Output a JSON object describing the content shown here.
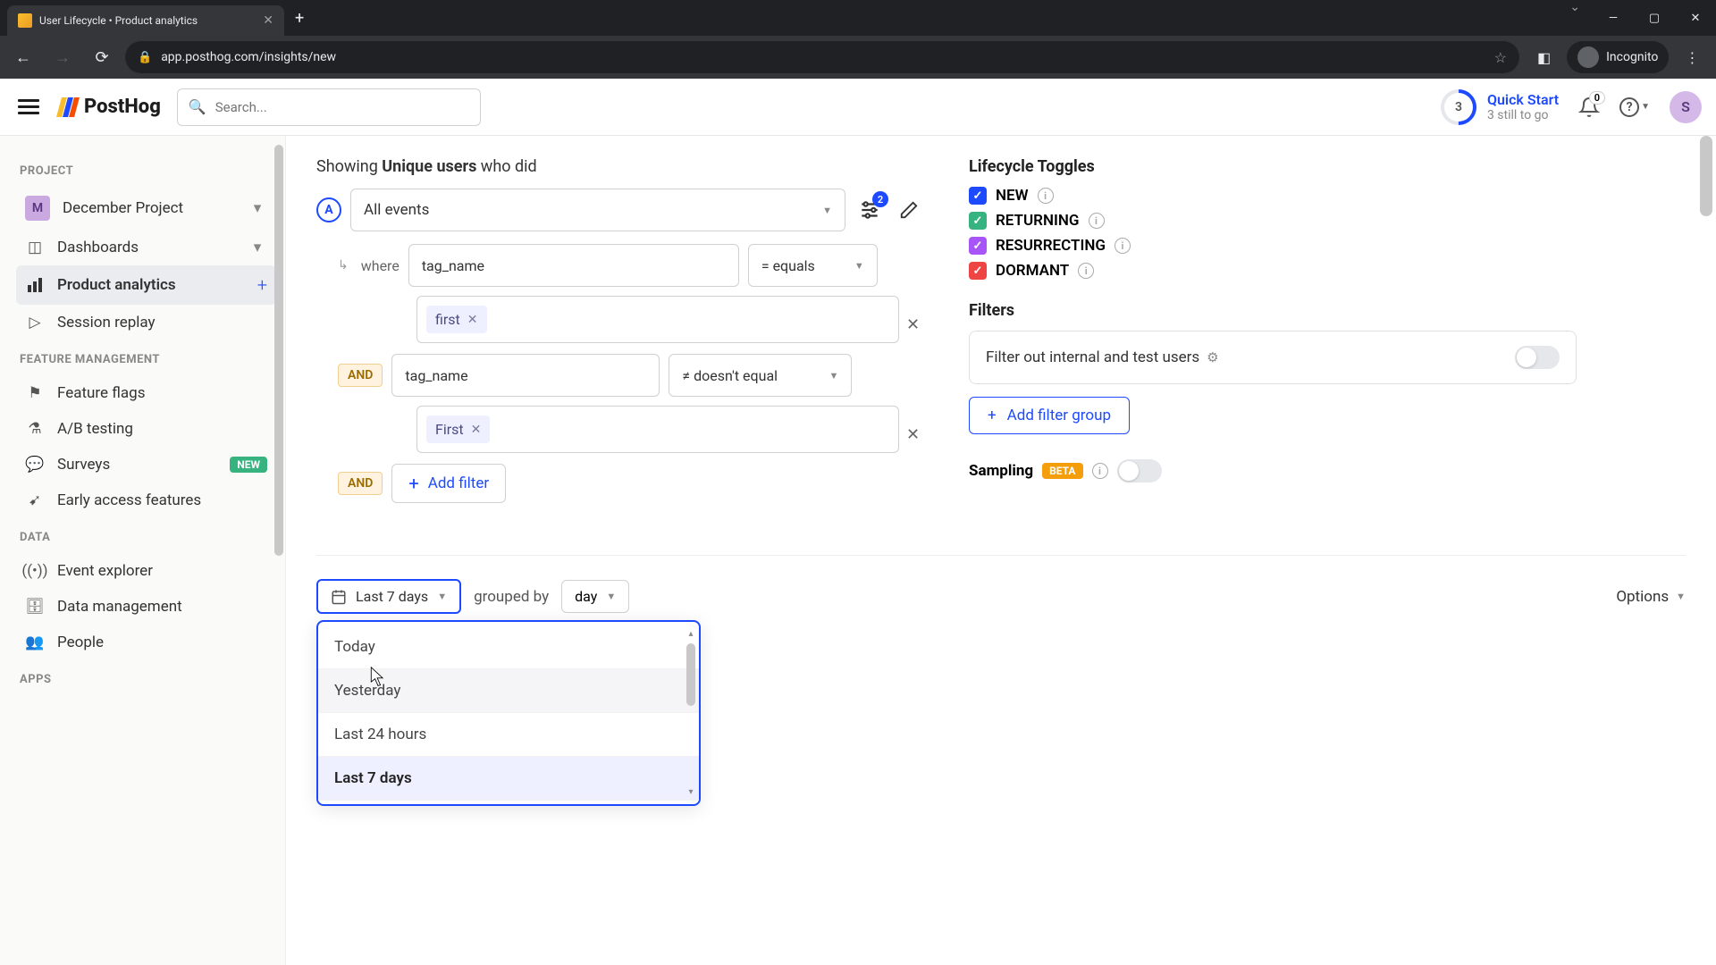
{
  "browser": {
    "tab_title": "User Lifecycle • Product analytics",
    "url": "app.posthog.com/insights/new",
    "incognito": "Incognito"
  },
  "app": {
    "logo": "PostHog",
    "search_placeholder": "Search...",
    "quickstart": {
      "count": "3",
      "title": "Quick Start",
      "subtitle": "3 still to go"
    },
    "notification_count": "0",
    "avatar_initial": "S"
  },
  "sidebar": {
    "project_section": "PROJECT",
    "project_initial": "M",
    "project_name": "December Project",
    "items": {
      "dashboards": "Dashboards",
      "product_analytics": "Product analytics",
      "session_replay": "Session replay"
    },
    "feature_section": "FEATURE MANAGEMENT",
    "feature_items": {
      "feature_flags": "Feature flags",
      "ab_testing": "A/B testing",
      "surveys": "Surveys",
      "surveys_badge": "NEW",
      "early_access": "Early access features"
    },
    "data_section": "DATA",
    "data_items": {
      "event_explorer": "Event explorer",
      "data_management": "Data management",
      "people": "People"
    },
    "apps_section": "APPS"
  },
  "query": {
    "showing_prefix": "Showing ",
    "showing_metric": "Unique users",
    "showing_suffix": " who did",
    "series_letter": "A",
    "event_name": "All events",
    "filter_count": "2",
    "where": "where",
    "and": "AND",
    "filters": [
      {
        "property": "tag_name",
        "operator": "= equals",
        "value": "first"
      },
      {
        "property": "tag_name",
        "operator": "≠ doesn't equal",
        "value": "First"
      }
    ],
    "add_filter": "Add filter"
  },
  "lifecycle": {
    "heading": "Lifecycle Toggles",
    "new": "NEW",
    "returning": "RETURNING",
    "resurrecting": "RESURRECTING",
    "dormant": "DORMANT"
  },
  "filters_section": {
    "heading": "Filters",
    "internal_label": "Filter out internal and test users",
    "add_group": "Add filter group"
  },
  "sampling": {
    "label": "Sampling",
    "badge": "BETA"
  },
  "date": {
    "range": "Last 7 days",
    "grouped_by": "grouped by",
    "interval": "day",
    "options": "Options",
    "dropdown": [
      "Today",
      "Yesterday",
      "Last 24 hours",
      "Last 7 days"
    ]
  }
}
